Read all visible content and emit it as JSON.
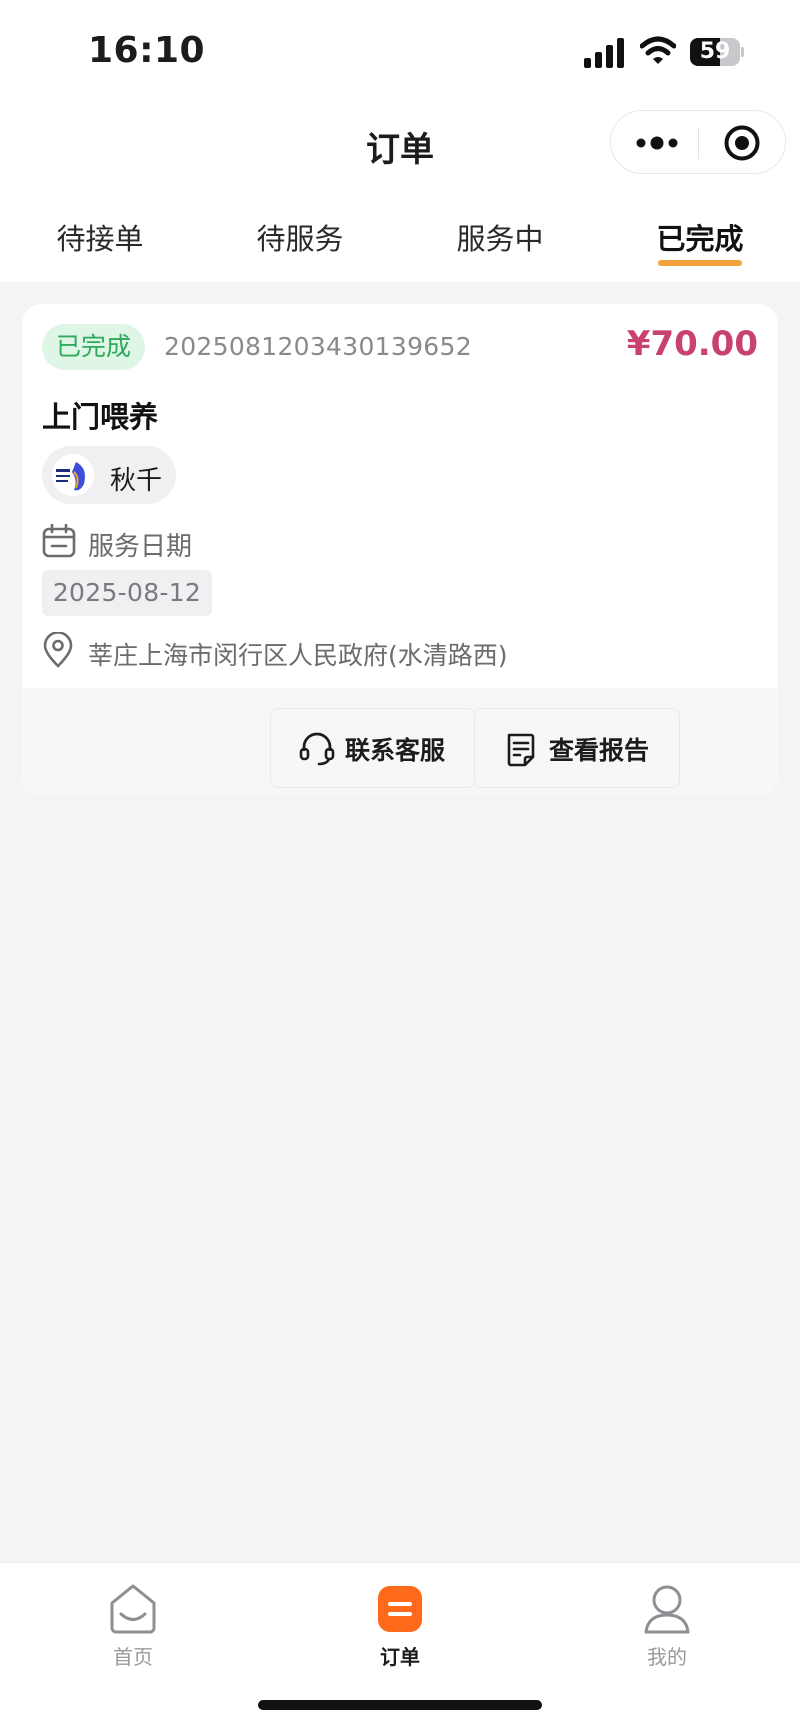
{
  "status_bar": {
    "time": "16:10",
    "battery_level": "59",
    "icons": [
      "signal-icon",
      "wifi-icon",
      "battery-icon"
    ]
  },
  "nav": {
    "title": "订单",
    "capsule_icons": [
      "more-icon",
      "close-target-icon"
    ]
  },
  "tabs": [
    {
      "label": "待接单",
      "active": false
    },
    {
      "label": "待服务",
      "active": false
    },
    {
      "label": "服务中",
      "active": false
    },
    {
      "label": "已完成",
      "active": true
    }
  ],
  "order": {
    "status": "已完成",
    "order_no": "2025081203430139652",
    "price": "¥70.00",
    "service_name": "上门喂养",
    "pet_name": "秋千",
    "date_label": "服务日期",
    "date": "2025-08-12",
    "address": "莘庄上海市闵行区人民政府(水清路西)",
    "actions": {
      "contact": "联系客服",
      "report": "查看报告"
    }
  },
  "tabbar": [
    {
      "label": "首页",
      "icon": "home-icon",
      "active": false
    },
    {
      "label": "订单",
      "icon": "orders-icon",
      "active": true
    },
    {
      "label": "我的",
      "icon": "profile-icon",
      "active": false
    }
  ],
  "colors": {
    "accent_orange": "#f3a23b",
    "tabbar_active": "#ff6a1a",
    "price": "#c8416f",
    "status_green": "#2daa5a",
    "status_green_bg": "#dff6e7",
    "page_bg": "#f4f4f5"
  }
}
